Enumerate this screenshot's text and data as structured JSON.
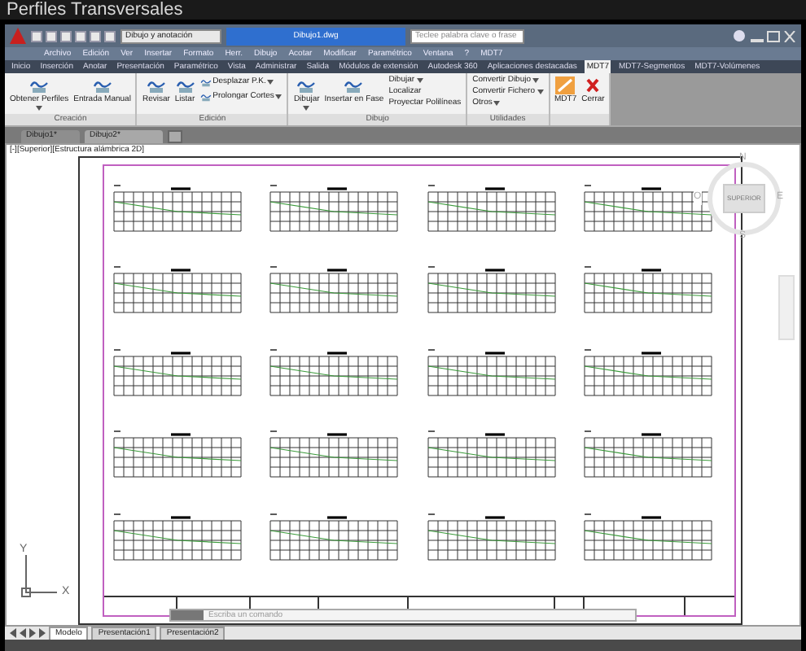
{
  "app_title": "Perfiles Transversales",
  "quick_access": {
    "workspace": "Dibujo y anotación",
    "document_title": "Dibujo1.dwg",
    "search": {
      "placeholder": "Teclee palabra clave o frase"
    }
  },
  "menu_bar": [
    "Archivo",
    "Edición",
    "Ver",
    "Insertar",
    "Formato",
    "Herr.",
    "Dibujo",
    "Acotar",
    "Modificar",
    "Paramétrico",
    "Ventana",
    "?",
    "MDT7"
  ],
  "ribbon_tabs": [
    {
      "label": "Inicio",
      "selected": false
    },
    {
      "label": "Inserción",
      "selected": false
    },
    {
      "label": "Anotar",
      "selected": false
    },
    {
      "label": "Presentación",
      "selected": false
    },
    {
      "label": "Paramétrico",
      "selected": false
    },
    {
      "label": "Vista",
      "selected": false
    },
    {
      "label": "Administrar",
      "selected": false
    },
    {
      "label": "Salida",
      "selected": false
    },
    {
      "label": "Módulos de extensión",
      "selected": false
    },
    {
      "label": "Autodesk 360",
      "selected": false
    },
    {
      "label": "Aplicaciones destacadas",
      "selected": false
    },
    {
      "label": "MDT7",
      "selected": true
    },
    {
      "label": "MDT7-Segmentos",
      "selected": false
    },
    {
      "label": "MDT7-Volúmenes",
      "selected": false
    }
  ],
  "ribbon_panels": [
    {
      "title": "Creación",
      "buttons": [
        {
          "kind": "large",
          "label": "Obtener Perfiles",
          "menu": true
        },
        {
          "kind": "large",
          "label": "Entrada Manual",
          "menu": false
        }
      ]
    },
    {
      "title": "Edición",
      "buttons": [
        {
          "kind": "large",
          "label": "Revisar",
          "menu": false
        },
        {
          "kind": "large",
          "label": "Listar",
          "menu": false
        },
        {
          "kind": "small",
          "label": "Desplazar P.K.",
          "menu": true
        },
        {
          "kind": "small",
          "label": "Prolongar Cortes",
          "menu": true
        }
      ]
    },
    {
      "title": "Dibujo",
      "buttons": [
        {
          "kind": "large",
          "label": "Dibujar",
          "menu": true
        },
        {
          "kind": "large",
          "label": "Insertar en Fase",
          "menu": false
        },
        {
          "kind": "small",
          "label": "Dibujar",
          "menu": true
        },
        {
          "kind": "small",
          "label": "Localizar",
          "menu": false
        },
        {
          "kind": "small",
          "label": "Proyectar Polilíneas",
          "menu": false
        }
      ]
    },
    {
      "title": "Utilidades",
      "buttons": [
        {
          "kind": "small",
          "label": "Convertir Dibujo",
          "menu": true
        },
        {
          "kind": "small",
          "label": "Convertir Fichero",
          "menu": true
        },
        {
          "kind": "small",
          "label": "Otros",
          "menu": true
        }
      ]
    },
    {
      "buttons": [
        {
          "kind": "large",
          "label": "MDT7",
          "menu": false
        },
        {
          "kind": "large",
          "label": "Cerrar",
          "menu": false
        }
      ]
    }
  ],
  "doc_tabs": [
    {
      "label": "Dibujo1*",
      "selected": false
    },
    {
      "label": "Dibujo2*",
      "selected": true
    }
  ],
  "viewport": {
    "label": "[-][Superior][Estructura alámbrica 2D]",
    "viewcube": {
      "face": "SUPERIOR",
      "north": "N",
      "east": "E",
      "south": "S",
      "west": "O"
    },
    "ucs": {
      "x": "X",
      "y": "Y"
    }
  },
  "command_line": {
    "placeholder": "Escriba un comando"
  },
  "layout_tabs": [
    {
      "label": "Modelo",
      "selected": true
    },
    {
      "label": "Presentación1",
      "selected": false
    },
    {
      "label": "Presentación2",
      "selected": false
    }
  ]
}
